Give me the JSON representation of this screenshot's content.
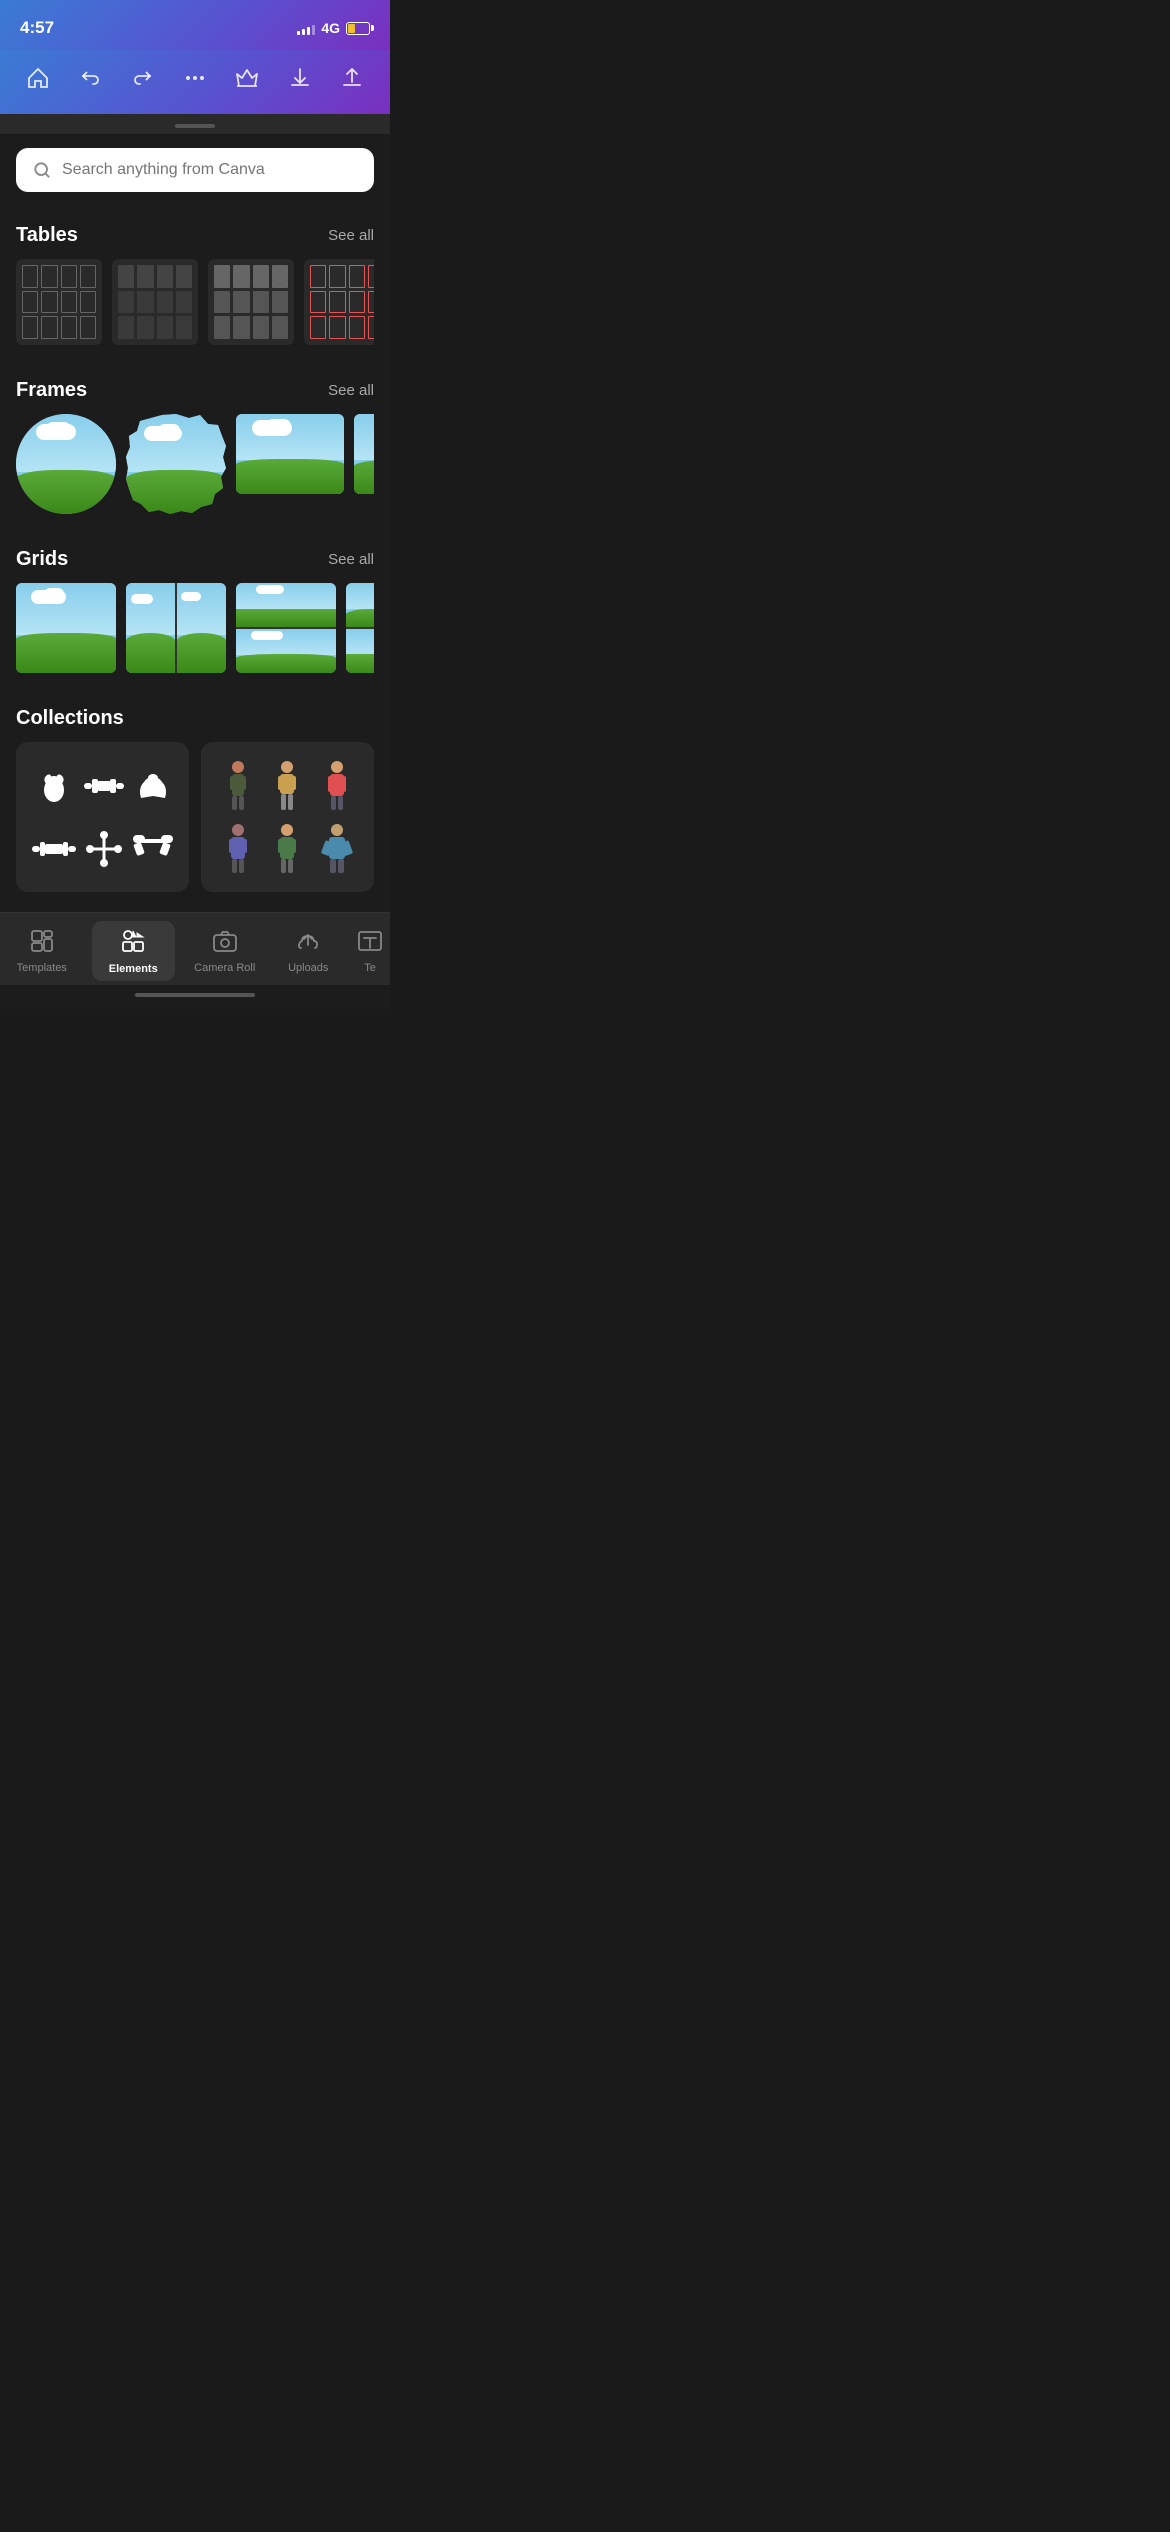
{
  "status": {
    "time": "4:57",
    "network": "4G",
    "signal_bars": [
      4,
      6,
      8,
      10,
      12
    ],
    "battery_percent": 35
  },
  "toolbar": {
    "home_label": "Home",
    "undo_label": "Undo",
    "redo_label": "Redo",
    "more_label": "More",
    "crown_label": "Crown",
    "download_label": "Download",
    "share_label": "Share"
  },
  "search": {
    "placeholder": "Search anything from Canva"
  },
  "sections": {
    "tables": {
      "title": "Tables",
      "see_all": "See all",
      "items": [
        {
          "style": "outline",
          "color": "white"
        },
        {
          "style": "filled",
          "color": "dark"
        },
        {
          "style": "filled",
          "color": "gray"
        },
        {
          "style": "filled",
          "color": "red"
        },
        {
          "style": "partial",
          "color": "red"
        }
      ]
    },
    "frames": {
      "title": "Frames",
      "see_all": "See all",
      "items": [
        "circle",
        "wavy-circle",
        "landscape-wide",
        "landscape-wide2",
        "partial"
      ]
    },
    "grids": {
      "title": "Grids",
      "see_all": "See all",
      "items": [
        "single",
        "two-col",
        "two-row",
        "four-grid",
        "partial"
      ]
    },
    "collections": {
      "title": "Collections",
      "items": [
        {
          "type": "fitness",
          "icons": [
            "💪",
            "🏋️",
            "👊",
            "🏋️",
            "⚙️",
            "🥊"
          ]
        },
        {
          "type": "people",
          "icons": [
            "🧍",
            "🧍‍♀️",
            "🧍‍♂️",
            "🧍‍♀️",
            "🧍",
            "🧍‍♂️"
          ]
        }
      ]
    }
  },
  "bottom_nav": {
    "items": [
      {
        "id": "templates",
        "label": "Templates",
        "icon": "⊞",
        "active": false
      },
      {
        "id": "elements",
        "label": "Elements",
        "icon": "♡△◻",
        "active": true
      },
      {
        "id": "camera-roll",
        "label": "Camera Roll",
        "icon": "📷",
        "active": false
      },
      {
        "id": "uploads",
        "label": "Uploads",
        "icon": "☁",
        "active": false
      },
      {
        "id": "te",
        "label": "Te",
        "active": false
      }
    ]
  }
}
